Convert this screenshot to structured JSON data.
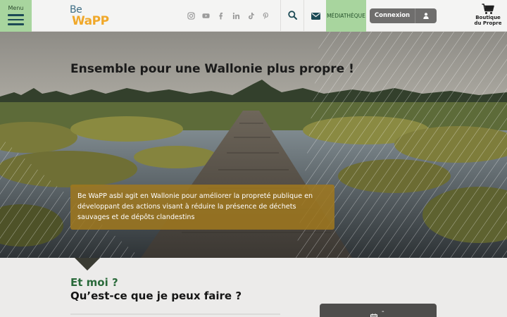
{
  "header": {
    "menu_label": "Menu",
    "logo": {
      "line1": "Be",
      "line2": "WaPP"
    },
    "socials": [
      "instagram-icon",
      "youtube-icon",
      "facebook-icon",
      "linkedin-icon",
      "tiktok-icon",
      "pinterest-icon"
    ],
    "search_icon": "search-icon",
    "mail_icon": "envelope-icon",
    "media_label": "MÉDIATHÈQUE",
    "login_label": "Connexion",
    "user_icon": "user-icon",
    "shop": {
      "icon": "cart-icon",
      "line1": "Boutique",
      "line2": "du Propre"
    }
  },
  "hero": {
    "title": "Ensemble pour une Wallonie plus propre !",
    "description": "Be WaPP asbl agit en Wallonie pour améliorer la propreté publique en développant des actions visant à réduire la présence de déchets sauvages et de dépôts clandestins"
  },
  "section": {
    "kicker": "Et moi ?",
    "heading": "Qu’est-ce que je peux faire ?"
  },
  "agenda": {
    "icon": "calendar-icon",
    "text": "-"
  },
  "colors": {
    "accent_green": "#a8d59e",
    "dark_teal": "#1c4a55",
    "logo_orange": "#f0a82a",
    "box_gold": "#a0781e",
    "kicker_green": "#2a6a3b"
  }
}
